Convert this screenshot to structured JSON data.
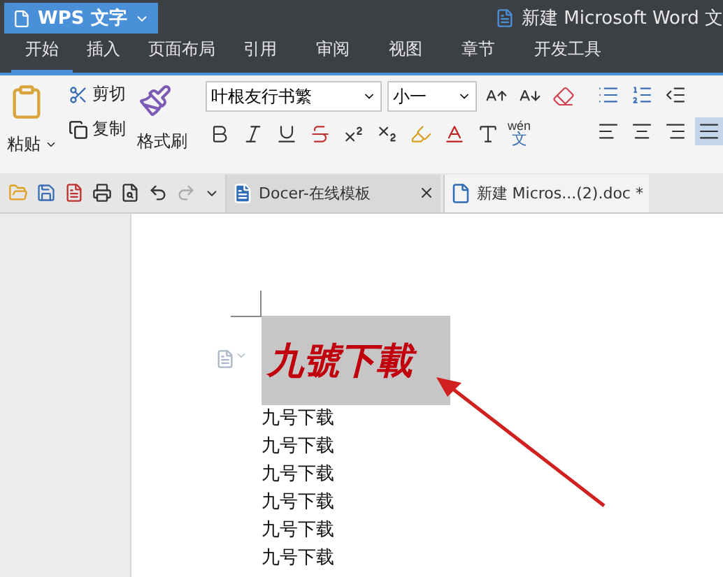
{
  "app_menu": {
    "label": "WPS 文字"
  },
  "window": {
    "title": "新建 Microsoft Word 文"
  },
  "tabs": [
    {
      "label": "开始",
      "selected": true
    },
    {
      "label": "插入",
      "selected": false
    },
    {
      "label": "页面布局",
      "selected": false
    },
    {
      "label": "引用",
      "selected": false
    },
    {
      "label": "审阅",
      "selected": false
    },
    {
      "label": "视图",
      "selected": false
    },
    {
      "label": "章节",
      "selected": false
    },
    {
      "label": "开发工具",
      "selected": false
    }
  ],
  "ribbon": {
    "paste": "粘贴",
    "cut": "剪切",
    "copy": "复制",
    "format_painter": "格式刷",
    "font": "叶根友行书繁",
    "size": "小一",
    "phonetic_top": "wén",
    "phonetic_bottom": "文",
    "alignments": [
      {
        "kind": "left",
        "selected": false
      },
      {
        "kind": "center",
        "selected": false
      },
      {
        "kind": "right",
        "selected": false
      },
      {
        "kind": "justify",
        "selected": true
      }
    ]
  },
  "doc_tabs": [
    {
      "label": "Docer-在线模板",
      "kind": "docer",
      "selected": false
    },
    {
      "label": "新建 Micros...(2).doc *",
      "kind": "word",
      "selected": true
    }
  ],
  "document": {
    "heading": {
      "text": "九號下載",
      "selected": true
    },
    "lines": [
      "九号下载",
      "九号下载",
      "九号下载",
      "九号下载",
      "九号下载",
      "九号下载"
    ]
  }
}
